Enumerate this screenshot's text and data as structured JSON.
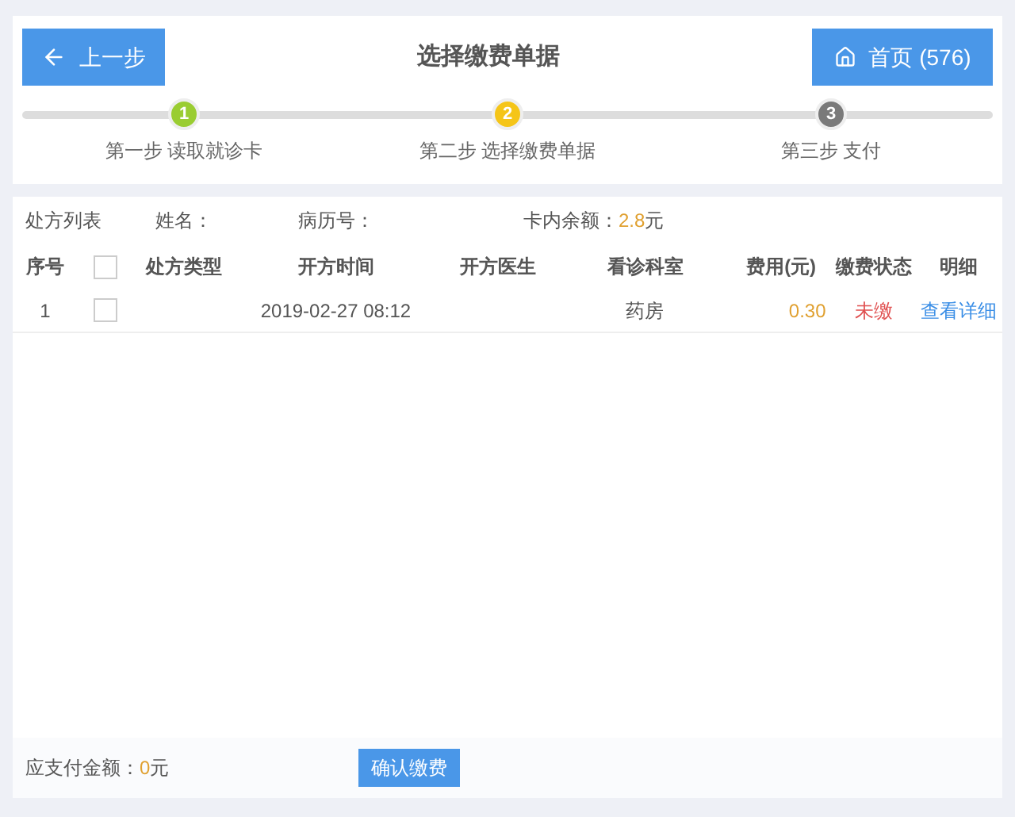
{
  "header": {
    "back_button": "上一步",
    "title": "选择缴费单据",
    "home_button": "首页 (576)"
  },
  "steps": [
    {
      "number": "1",
      "label": "第一步 读取就诊卡",
      "color": "#9acd32"
    },
    {
      "number": "2",
      "label": "第二步 选择缴费单据",
      "color": "#f5c518"
    },
    {
      "number": "3",
      "label": "第三步 支付",
      "color": "#7a7a7a"
    }
  ],
  "info": {
    "title": "处方列表",
    "name_label": "姓名：",
    "record_label": "病历号：",
    "balance_label": "卡内余额：",
    "balance_value": "2.8",
    "balance_unit": "元"
  },
  "table": {
    "columns": [
      {
        "kind": "text",
        "label": "序号"
      },
      {
        "kind": "checkbox",
        "checked": false
      },
      {
        "kind": "text",
        "label": "处方类型"
      },
      {
        "kind": "text",
        "label": "开方时间"
      },
      {
        "kind": "text",
        "label": "开方医生"
      },
      {
        "kind": "text",
        "label": "看诊科室"
      },
      {
        "kind": "text",
        "label": "费用(元)"
      },
      {
        "kind": "text",
        "label": "缴费状态"
      },
      {
        "kind": "text",
        "label": "明细"
      }
    ],
    "rows": [
      {
        "index": "1",
        "checked": false,
        "time": "2019-02-27 08:12",
        "department": "药房",
        "fee": "0.30",
        "status": "未缴",
        "detail": "查看详细"
      }
    ]
  },
  "footer": {
    "amount_label": "应支付金额：",
    "amount_value": "0",
    "amount_unit": "元",
    "confirm_button": "确认缴费"
  }
}
